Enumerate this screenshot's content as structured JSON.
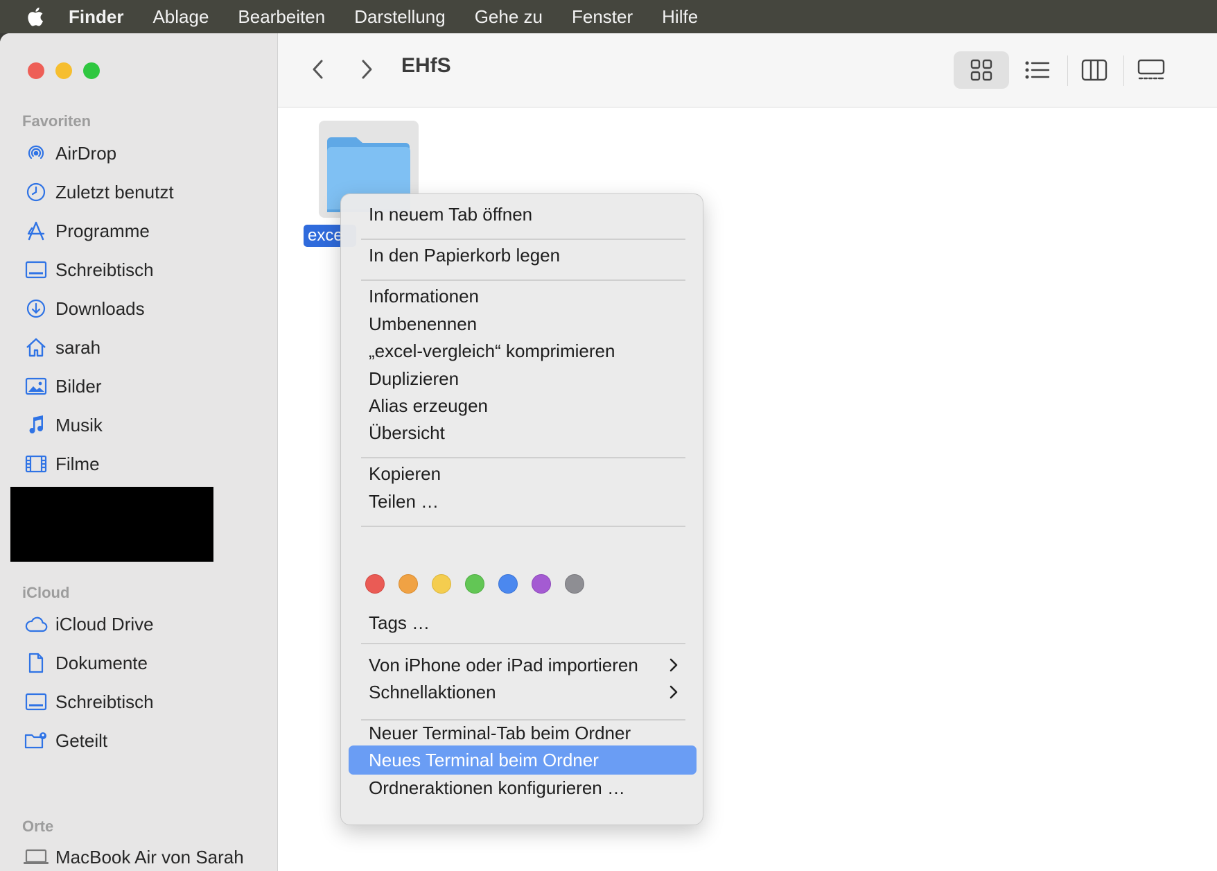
{
  "menubar": {
    "items": [
      {
        "label": "Finder",
        "bold": true
      },
      {
        "label": "Ablage"
      },
      {
        "label": "Bearbeiten"
      },
      {
        "label": "Darstellung"
      },
      {
        "label": "Gehe zu"
      },
      {
        "label": "Fenster"
      },
      {
        "label": "Hilfe"
      }
    ]
  },
  "sidebar": {
    "favorites_heading": "Favoriten",
    "favorites": [
      {
        "label": "AirDrop",
        "icon": "airdrop-icon"
      },
      {
        "label": "Zuletzt benutzt",
        "icon": "clock-icon"
      },
      {
        "label": "Programme",
        "icon": "apps-icon"
      },
      {
        "label": "Schreibtisch",
        "icon": "desktop-icon"
      },
      {
        "label": "Downloads",
        "icon": "download-icon"
      },
      {
        "label": "sarah",
        "icon": "home-icon"
      },
      {
        "label": "Bilder",
        "icon": "pictures-icon"
      },
      {
        "label": "Musik",
        "icon": "music-icon"
      },
      {
        "label": "Filme",
        "icon": "film-icon"
      }
    ],
    "icloud_heading": "iCloud",
    "icloud": [
      {
        "label": "iCloud Drive",
        "icon": "cloud-icon"
      },
      {
        "label": "Dokumente",
        "icon": "document-icon"
      },
      {
        "label": "Schreibtisch",
        "icon": "desktop-icon"
      },
      {
        "label": "Geteilt",
        "icon": "shared-folder-icon"
      }
    ],
    "places_heading": "Orte",
    "places": [
      {
        "label": "MacBook Air von Sarah",
        "icon": "laptop-icon"
      }
    ]
  },
  "toolbar": {
    "title": "EHfS",
    "active_view": "icon"
  },
  "content": {
    "file_label": "exce"
  },
  "context_menu": {
    "open_new_tab": "In neuem Tab öffnen",
    "move_to_trash": "In den Papierkorb legen",
    "info": "Informationen",
    "rename": "Umbenennen",
    "compress": "„excel-vergleich“ komprimieren",
    "duplicate": "Duplizieren",
    "make_alias": "Alias erzeugen",
    "quick_look": "Übersicht",
    "copy": "Kopieren",
    "share": "Teilen …",
    "tags": "Tags …",
    "import_iphone": "Von iPhone oder iPad importieren",
    "quick_actions": "Schnellaktionen",
    "new_terminal_tab": "Neuer Terminal-Tab beim Ordner",
    "new_terminal": "Neues Terminal beim Ordner",
    "folder_actions": "Ordneraktionen konfigurieren …",
    "highlighted_item": "new_terminal",
    "tag_colors": [
      "#ea5b55",
      "#f0a244",
      "#f4cd4f",
      "#62c655",
      "#4b88ef",
      "#a45bd2",
      "#8e8e93"
    ]
  },
  "colors": {
    "accent": "#2f6bdc",
    "highlight": "#6a9df4",
    "sidebar_icon": "#2f73e5"
  }
}
